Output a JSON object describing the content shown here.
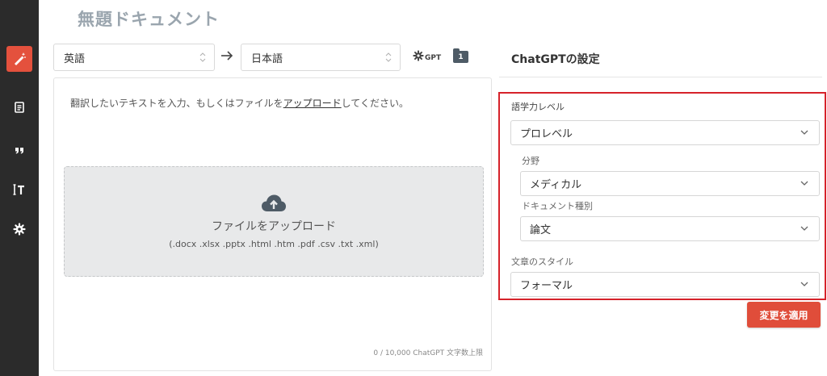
{
  "document": {
    "title": "無題ドキュメント"
  },
  "sidebar": {
    "items": [
      {
        "name": "edit",
        "icon": "magic-pen-icon",
        "active": true
      },
      {
        "name": "documents",
        "icon": "document-icon"
      },
      {
        "name": "quotes",
        "icon": "quote-icon"
      },
      {
        "name": "text",
        "icon": "text-cursor-icon"
      },
      {
        "name": "settings",
        "icon": "gear-icon"
      }
    ]
  },
  "toolbar": {
    "source_language": "英語",
    "target_language": "日本語",
    "gpt_label": "GPT",
    "folder_badge": "1"
  },
  "editor": {
    "hint_prefix": "翻訳したいテキストを入力、もしくはファイルを",
    "hint_link": "アップロード",
    "hint_suffix": "してください。",
    "upload_title": "ファイルをアップロード",
    "upload_formats": "(.docx .xlsx .pptx .html .htm .pdf .csv .txt .xml)",
    "counter": "0 / 10,000 ChatGPT 文字数上限"
  },
  "settings": {
    "title": "ChatGPTの設定",
    "language_level_label": "語学力レベル",
    "language_level_value": "プロレベル",
    "field_label": "分野",
    "field_value": "メディカル",
    "doc_type_label": "ドキュメント種別",
    "doc_type_value": "論文",
    "style_label": "文章のスタイル",
    "style_value": "フォーマル",
    "apply_label": "変更を適用"
  },
  "colors": {
    "accent": "#e4513d",
    "sidebar_bg": "#2b2b2b",
    "highlight_border": "#d6222a"
  }
}
